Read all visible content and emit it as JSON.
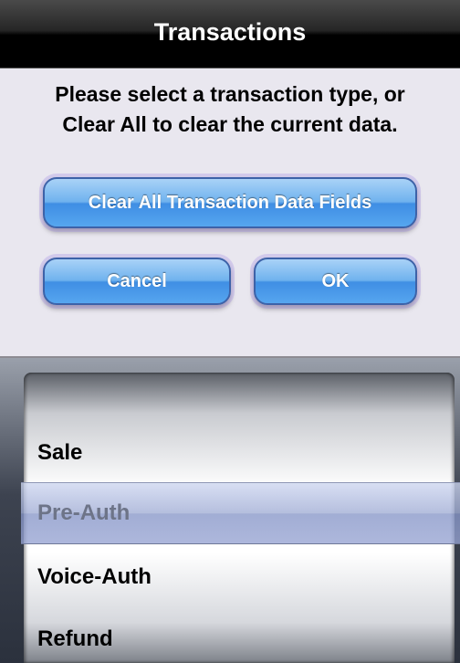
{
  "title_bar": {
    "title": "Transactions"
  },
  "prompt": {
    "line1": "Please select a transaction type, or",
    "line2": "Clear All to clear the current data."
  },
  "buttons": {
    "clear_all": "Clear All Transaction Data Fields",
    "cancel": "Cancel",
    "ok": "OK"
  },
  "picker": {
    "items": [
      "Sale",
      "Pre-Auth",
      "Voice-Auth",
      "Refund"
    ],
    "selected": "Pre-Auth"
  }
}
